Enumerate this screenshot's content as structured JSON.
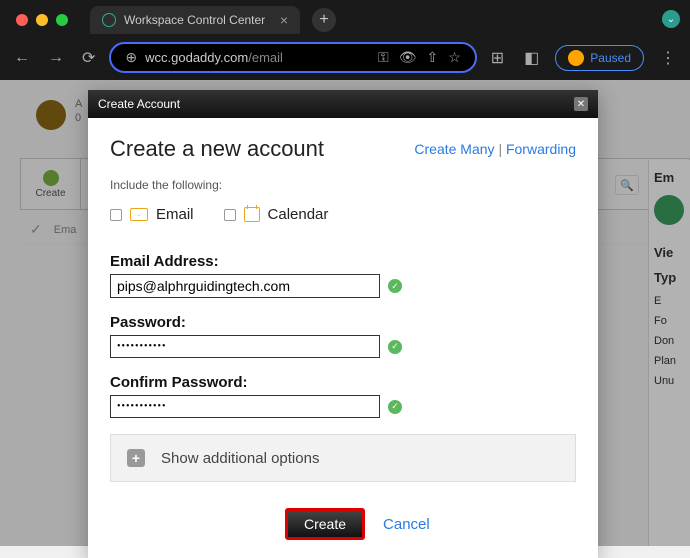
{
  "browser": {
    "tab_title": "Workspace Control Center",
    "url_host": "wcc.godaddy.com",
    "url_path": "/email",
    "paused_label": "Paused"
  },
  "page_bg": {
    "avatar_label1": "A",
    "avatar_label2": "0",
    "toolbar_create": "Create",
    "email_col": "Ema",
    "right_panel": {
      "em": "Em",
      "vie": "Vie",
      "typ": "Typ",
      "e": "E",
      "fo": "Fo",
      "don": "Don",
      "plan": "Plan",
      "unu": "Unu"
    }
  },
  "modal": {
    "header": "Create Account",
    "title": "Create a new account",
    "link_create_many": "Create Many",
    "link_forwarding": "Forwarding",
    "include_text": "Include the following:",
    "checkbox_email": "Email",
    "checkbox_calendar": "Calendar",
    "label_email": "Email Address:",
    "value_email": "pips@alphrguidingtech.com",
    "label_password": "Password:",
    "value_password": "•••••••••••",
    "label_confirm": "Confirm Password:",
    "value_confirm": "•••••••••••",
    "additional": "Show additional options",
    "btn_create": "Create",
    "btn_cancel": "Cancel"
  }
}
